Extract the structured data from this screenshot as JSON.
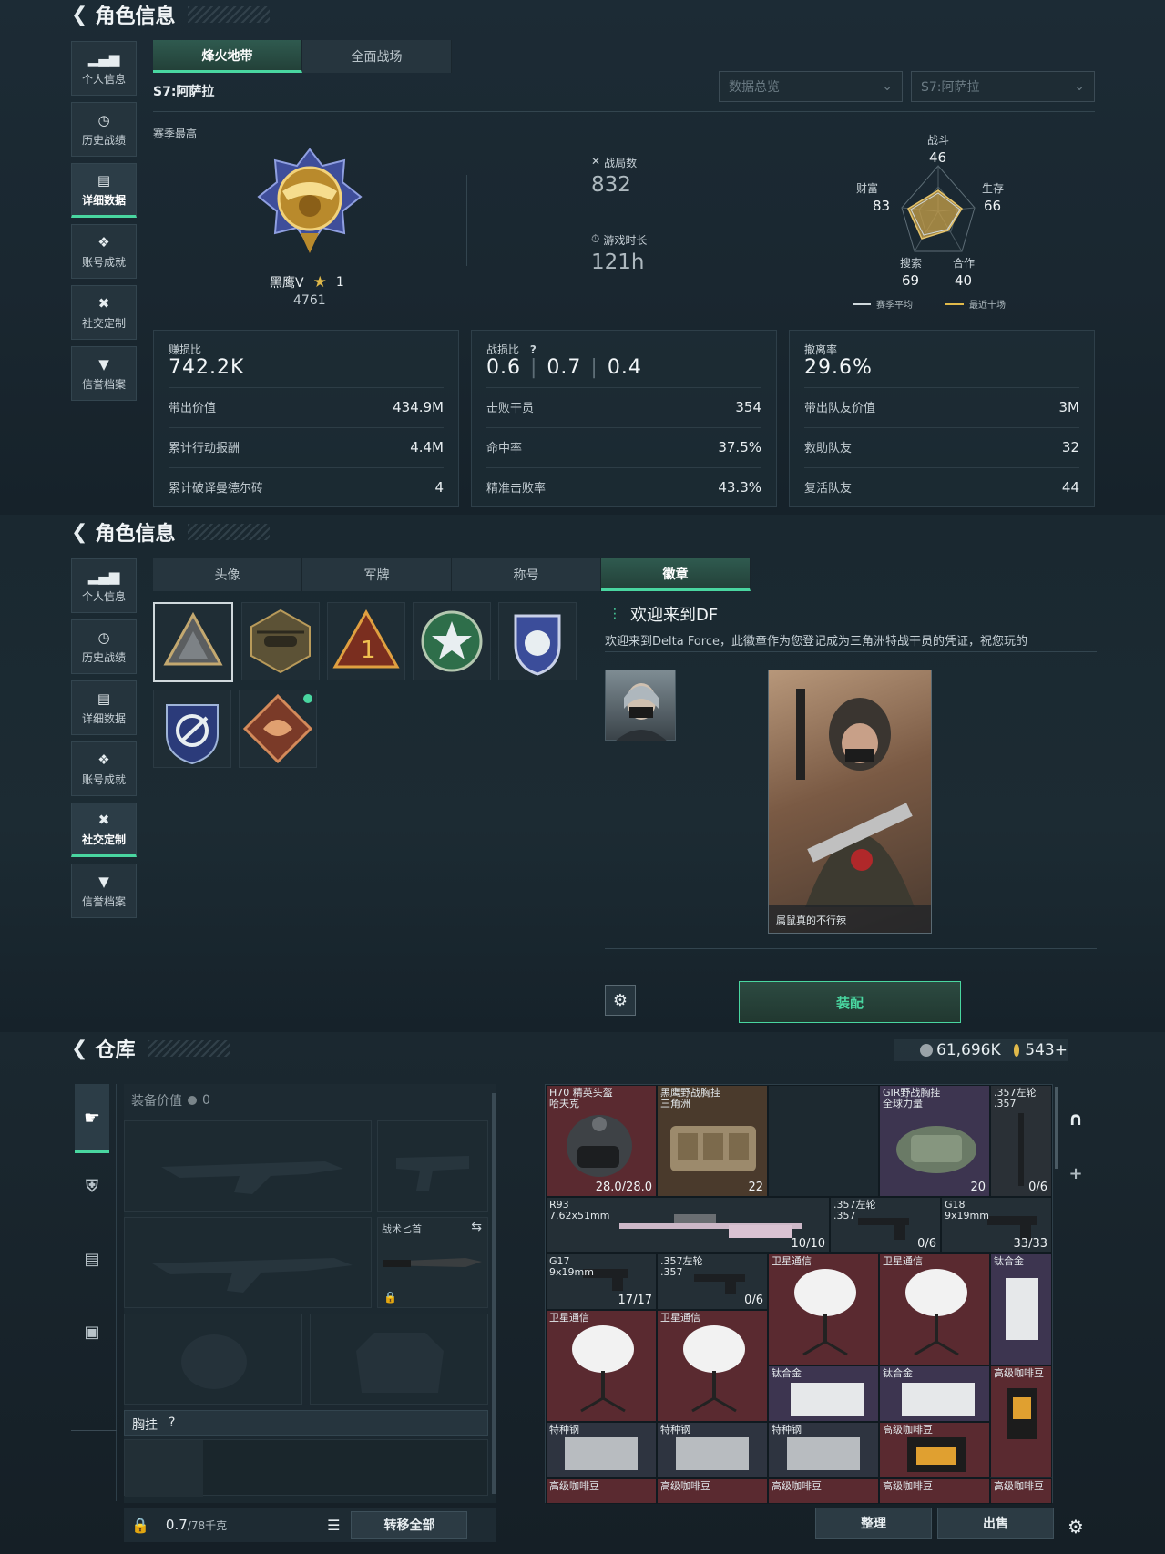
{
  "panel1": {
    "title": "角色信息",
    "sidebar": [
      {
        "label": "个人信息",
        "icon": "bar-chart-icon"
      },
      {
        "label": "历史战绩",
        "icon": "clock-icon"
      },
      {
        "label": "详细数据",
        "icon": "folder-icon"
      },
      {
        "label": "账号成就",
        "icon": "medal-icon"
      },
      {
        "label": "社交定制",
        "icon": "tools-icon"
      },
      {
        "label": "信誉档案",
        "icon": "shield-icon"
      }
    ],
    "active_sidebar": 2,
    "tabs": [
      "烽火地带",
      "全面战场"
    ],
    "season_label": "S7:阿萨拉",
    "dropdown_overview": "数据总览",
    "dropdown_season": "S7:阿萨拉",
    "season_best": "赛季最高",
    "rank_name": "黑鹰V",
    "rank_stars": "1",
    "rank_score": "4761",
    "matches_label": "战局数",
    "matches_value": "832",
    "playtime_label": "游戏时长",
    "playtime_value": "121h",
    "radar": {
      "labels": {
        "combat": "战斗",
        "survival": "生存",
        "teamwork": "合作",
        "search": "搜索",
        "wealth": "财富"
      },
      "values": {
        "combat": "46",
        "survival": "66",
        "teamwork": "40",
        "search": "69",
        "wealth": "83"
      },
      "legend_season": "赛季平均",
      "legend_recent": "最近十场"
    },
    "card1": {
      "head": "赚损比",
      "big": "742.2K",
      "rows": [
        [
          "带出价值",
          "434.9M"
        ],
        [
          "累计行动报酬",
          "4.4M"
        ],
        [
          "累计破译曼德尔砖",
          "4"
        ]
      ]
    },
    "card2": {
      "head": "战损比",
      "help": "?",
      "big1": "0.6",
      "big2": "0.7",
      "big3": "0.4",
      "rows": [
        [
          "击败干员",
          "354"
        ],
        [
          "命中率",
          "37.5%"
        ],
        [
          "精准击败率",
          "43.3%"
        ]
      ]
    },
    "card3": {
      "head": "撤离率",
      "big": "29.6%",
      "rows": [
        [
          "带出队友价值",
          "3M"
        ],
        [
          "救助队友",
          "32"
        ],
        [
          "复活队友",
          "44"
        ]
      ]
    }
  },
  "panel2": {
    "title": "角色信息",
    "sidebar": [
      {
        "label": "个人信息",
        "icon": "bar-chart-icon"
      },
      {
        "label": "历史战绩",
        "icon": "clock-icon"
      },
      {
        "label": "详细数据",
        "icon": "folder-icon"
      },
      {
        "label": "账号成就",
        "icon": "medal-icon"
      },
      {
        "label": "社交定制",
        "icon": "tools-icon"
      },
      {
        "label": "信誉档案",
        "icon": "shield-icon"
      }
    ],
    "active_sidebar": 4,
    "tabs": [
      "头像",
      "军牌",
      "称号",
      "徽章"
    ],
    "badge_title": "欢迎来到DF",
    "badge_desc": "欢迎来到Delta Force，此徽章作为您登记成为三角洲特战干员的凭证，祝您玩的",
    "card_caption": "属鼠真的不行辣",
    "equip_button": "装配"
  },
  "panel3": {
    "title": "仓库",
    "currency1": "61,696K",
    "currency2": "543+",
    "equip_value_label": "装备价值",
    "equip_value": "0",
    "knife_label": "战术匕首",
    "chest_label": "胸挂",
    "chest_help": "?",
    "weight": "0.7",
    "weight_max": "/78千克",
    "transfer_all": "转移全部",
    "sort_button": "整理",
    "sell_button": "出售",
    "items": [
      {
        "name": "H70 精英头盔\n哈夫克",
        "qty": "28.0/28.0"
      },
      {
        "name": "黑鹰野战胸挂\n三角洲",
        "qty": "22"
      },
      {
        "name": "GIR野战胸挂\n全球力量",
        "qty": "20"
      },
      {
        "name": ".357左轮\n.357",
        "qty": "0/6"
      },
      {
        "name": "R93\n7.62x51mm",
        "qty": "10/10"
      },
      {
        "name": ".357左轮\n.357",
        "qty": "0/6"
      },
      {
        "name": "G18\n9x19mm",
        "qty": "33/33"
      },
      {
        "name": "G17\n9x19mm",
        "qty": "17/17"
      },
      {
        "name": ".357左轮\n.357",
        "qty": "0/6"
      },
      {
        "name": "卫星通信",
        "qty": ""
      },
      {
        "name": "卫星通信",
        "qty": ""
      },
      {
        "name": "钛合金",
        "qty": ""
      },
      {
        "name": "卫星通信",
        "qty": ""
      },
      {
        "name": "卫星通信",
        "qty": ""
      },
      {
        "name": "钛合金",
        "qty": ""
      },
      {
        "name": "钛合金",
        "qty": ""
      },
      {
        "name": "高级咖啡豆",
        "qty": ""
      },
      {
        "name": "特种钢",
        "qty": ""
      },
      {
        "name": "特种钢",
        "qty": ""
      },
      {
        "name": "特种钢",
        "qty": ""
      },
      {
        "name": "高级咖啡豆",
        "qty": ""
      },
      {
        "name": "高级咖啡豆",
        "qty": ""
      },
      {
        "name": "高级咖啡豆",
        "qty": ""
      },
      {
        "name": "高级咖啡豆",
        "qty": ""
      },
      {
        "name": "高级咖啡豆",
        "qty": ""
      },
      {
        "name": "高级咖啡豆",
        "qty": ""
      }
    ]
  },
  "colors": {
    "accent": "#49d6a0",
    "rare_red": "#5a2a30",
    "epic_purple": "#3d3550",
    "gold": "#e0b94a"
  }
}
